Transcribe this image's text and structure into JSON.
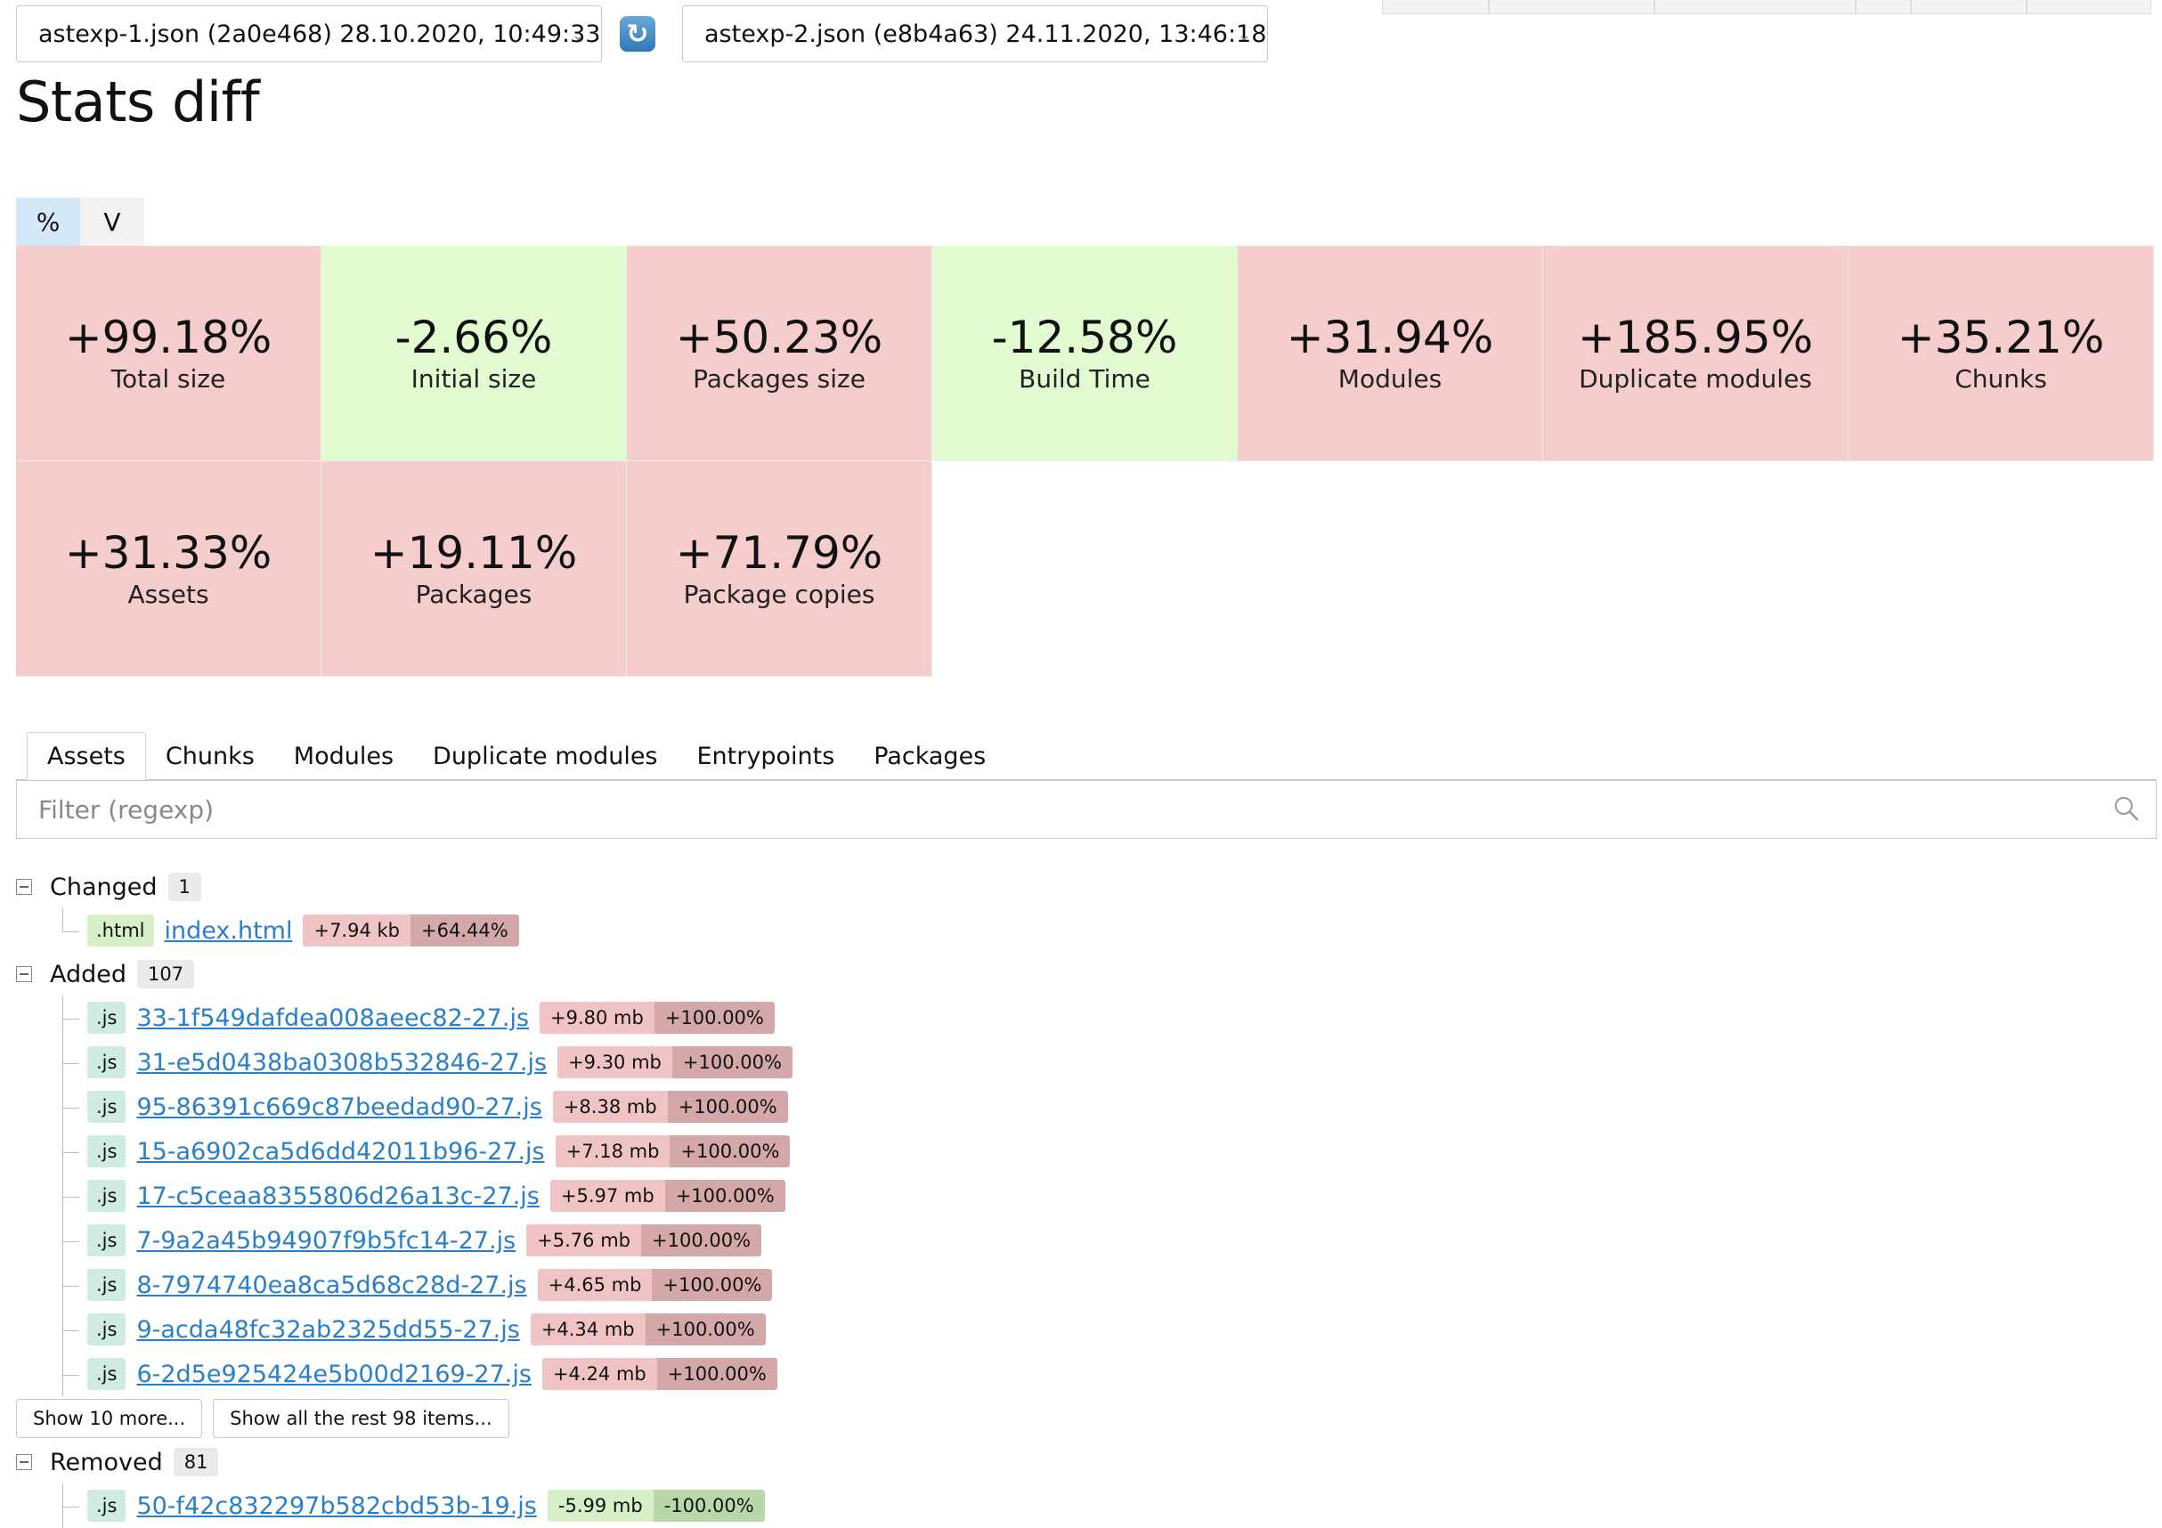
{
  "selectors": {
    "left": "astexp-1.json (2a0e468) 28.10.2020, 10:49:33",
    "right": "astexp-2.json (e8b4a63) 24.11.2020, 13:46:18"
  },
  "title": "Stats diff",
  "toggle": {
    "percent": "%",
    "value": "V"
  },
  "tiles": [
    {
      "value": "+99.18%",
      "label": "Total size",
      "state": "bad"
    },
    {
      "value": "-2.66%",
      "label": "Initial size",
      "state": "good"
    },
    {
      "value": "+50.23%",
      "label": "Packages size",
      "state": "bad"
    },
    {
      "value": "-12.58%",
      "label": "Build Time",
      "state": "good"
    },
    {
      "value": "+31.94%",
      "label": "Modules",
      "state": "bad"
    },
    {
      "value": "+185.95%",
      "label": "Duplicate modules",
      "state": "bad"
    },
    {
      "value": "+35.21%",
      "label": "Chunks",
      "state": "bad"
    },
    {
      "value": "+31.33%",
      "label": "Assets",
      "state": "bad"
    },
    {
      "value": "+19.11%",
      "label": "Packages",
      "state": "bad"
    },
    {
      "value": "+71.79%",
      "label": "Package copies",
      "state": "bad"
    }
  ],
  "tabs": [
    "Assets",
    "Chunks",
    "Modules",
    "Duplicate modules",
    "Entrypoints",
    "Packages"
  ],
  "filter": {
    "placeholder": "Filter (regexp)"
  },
  "groups": {
    "changed": {
      "title": "Changed",
      "count": "1",
      "items": [
        {
          "ext": ".html",
          "name": "index.html",
          "size": "+7.94 kb",
          "pct": "+64.44%"
        }
      ]
    },
    "added": {
      "title": "Added",
      "count": "107",
      "items": [
        {
          "ext": ".js",
          "name": "33-1f549dafdea008aeec82-27.js",
          "size": "+9.80 mb",
          "pct": "+100.00%"
        },
        {
          "ext": ".js",
          "name": "31-e5d0438ba0308b532846-27.js",
          "size": "+9.30 mb",
          "pct": "+100.00%"
        },
        {
          "ext": ".js",
          "name": "95-86391c669c87beedad90-27.js",
          "size": "+8.38 mb",
          "pct": "+100.00%"
        },
        {
          "ext": ".js",
          "name": "15-a6902ca5d6dd42011b96-27.js",
          "size": "+7.18 mb",
          "pct": "+100.00%"
        },
        {
          "ext": ".js",
          "name": "17-c5ceaa8355806d26a13c-27.js",
          "size": "+5.97 mb",
          "pct": "+100.00%"
        },
        {
          "ext": ".js",
          "name": "7-9a2a45b94907f9b5fc14-27.js",
          "size": "+5.76 mb",
          "pct": "+100.00%"
        },
        {
          "ext": ".js",
          "name": "8-7974740ea8ca5d68c28d-27.js",
          "size": "+4.65 mb",
          "pct": "+100.00%"
        },
        {
          "ext": ".js",
          "name": "9-acda48fc32ab2325dd55-27.js",
          "size": "+4.34 mb",
          "pct": "+100.00%"
        },
        {
          "ext": ".js",
          "name": "6-2d5e925424e5b00d2169-27.js",
          "size": "+4.24 mb",
          "pct": "+100.00%"
        }
      ],
      "show_more": "Show 10 more...",
      "show_all": "Show all the rest 98 items..."
    },
    "removed": {
      "title": "Removed",
      "count": "81",
      "items": [
        {
          "ext": ".js",
          "name": "50-f42c832297b582cbd53b-19.js",
          "size": "-5.99 mb",
          "pct": "-100.00%"
        }
      ]
    }
  },
  "colors": {
    "bad": "#f6cdcd",
    "good": "#e3fbd0",
    "link": "#2a7fc9",
    "toggle_active": "#d5e8f9"
  },
  "icons": {
    "swap": "refresh-icon",
    "search": "search-icon",
    "chevron": "chevron-down-icon"
  }
}
